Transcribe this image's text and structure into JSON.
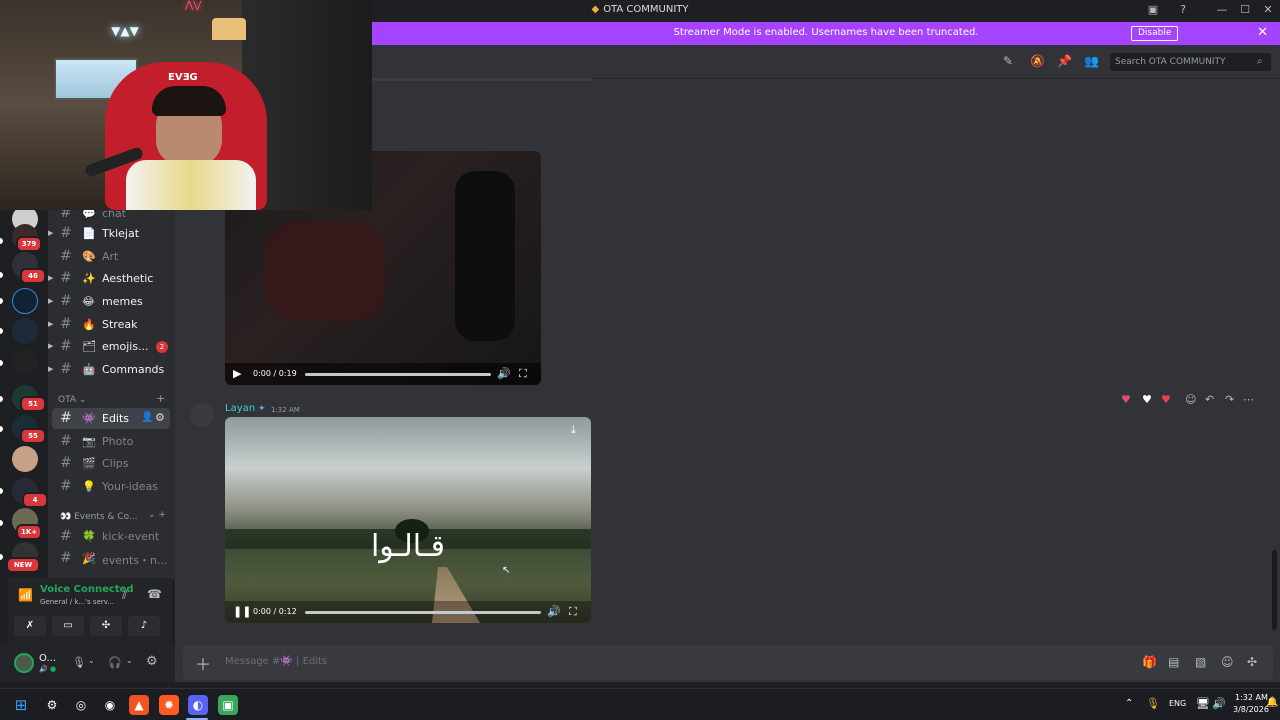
{
  "window": {
    "title": "OTA COMMUNITY",
    "controls": [
      "—",
      "☐",
      "✕"
    ]
  },
  "banner": {
    "message": "Streamer Mode is enabled. Usernames have been truncated.",
    "disable_label": "Disable",
    "color": "#a544ff"
  },
  "servers": {
    "badges": [
      "379",
      "46",
      "51",
      "55",
      "4",
      "1K+",
      "NEW"
    ]
  },
  "channels": {
    "top_partial": "chat",
    "list": [
      {
        "emoji": "📄",
        "label": "Tklejat",
        "unread": true
      },
      {
        "emoji": "🎨",
        "label": "Art",
        "unread": false
      },
      {
        "emoji": "✨",
        "label": "Aesthetic",
        "unread": true
      },
      {
        "emoji": "😂",
        "label": "memes",
        "unread": true
      },
      {
        "emoji": "🔥",
        "label": "Streak",
        "unread": true
      },
      {
        "emoji": "🗂",
        "label": "emojis...",
        "unread": true,
        "mentions": "2"
      },
      {
        "emoji": "🤖",
        "label": "Commands",
        "unread": true
      }
    ],
    "category_ota": "OTA",
    "ota_list": [
      {
        "emoji": "👾",
        "label": "Edits",
        "active": true
      },
      {
        "emoji": "📷",
        "label": "Photo"
      },
      {
        "emoji": "🎬",
        "label": "Clips"
      },
      {
        "emoji": "💡",
        "label": "Your-ideas"
      }
    ],
    "category_events": "Events & Co...",
    "events_list": [
      {
        "emoji": "🍀",
        "label": "kick-event"
      },
      {
        "emoji": "🎉",
        "label": "events・n..."
      }
    ]
  },
  "voice": {
    "status": "Voice Connected",
    "channel": "General / k...'s serv..."
  },
  "user": {
    "name": "O..."
  },
  "search": {
    "placeholder": "Search OTA COMMUNITY"
  },
  "messages": {
    "video1": {
      "time": "0:00 / 0:19",
      "progress": 1.0
    },
    "message2": {
      "author": "Layan",
      "timestamp": "1:32 AM",
      "video": {
        "time": "0:00 / 0:12",
        "progress": 0.0,
        "overlay_text": "قـالـوا"
      }
    }
  },
  "composer": {
    "placeholder": "Message #👾 | Edits"
  },
  "taskbar": {
    "language": "ENG",
    "time": "1:32 AM",
    "date": "3/8/2026"
  }
}
